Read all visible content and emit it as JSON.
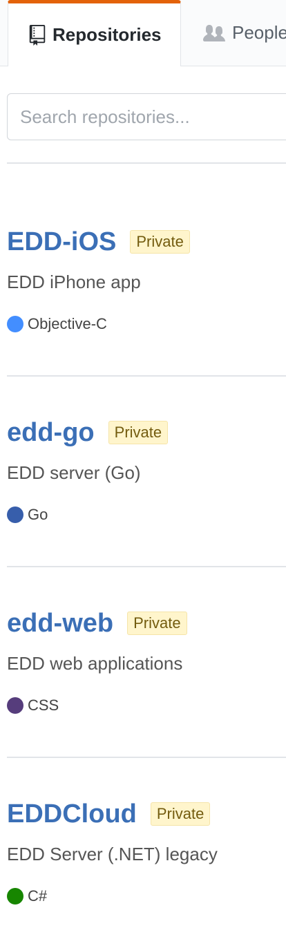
{
  "tabs": {
    "repositories": "Repositories",
    "people": "People"
  },
  "search": {
    "placeholder": "Search repositories..."
  },
  "repos": [
    {
      "name": "EDD-iOS",
      "badge": "Private",
      "description": "EDD iPhone app",
      "language": "Objective-C",
      "language_color": "#438eff"
    },
    {
      "name": "edd-go",
      "badge": "Private",
      "description": "EDD server (Go)",
      "language": "Go",
      "language_color": "#375eab"
    },
    {
      "name": "edd-web",
      "badge": "Private",
      "description": "EDD web applications",
      "language": "CSS",
      "language_color": "#563d7c"
    },
    {
      "name": "EDDCloud",
      "badge": "Private",
      "description": "EDD Server (.NET) legacy",
      "language": "C#",
      "language_color": "#178600"
    }
  ]
}
